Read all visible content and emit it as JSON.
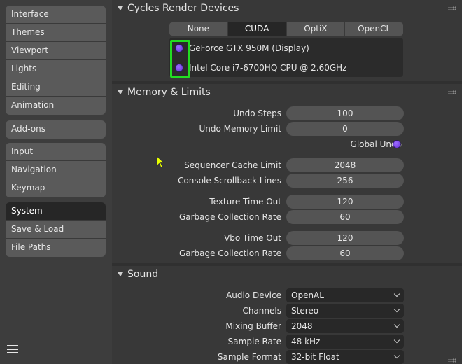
{
  "sidebar": {
    "groups": [
      [
        "Interface",
        "Themes",
        "Viewport",
        "Lights",
        "Editing",
        "Animation"
      ],
      [
        "Add-ons"
      ],
      [
        "Input",
        "Navigation",
        "Keymap"
      ],
      [
        "System",
        "Save & Load",
        "File Paths"
      ]
    ],
    "active": "System"
  },
  "cycles": {
    "title": "Cycles Render Devices",
    "tabs": [
      "None",
      "CUDA",
      "OptiX",
      "OpenCL"
    ],
    "active_tab": "CUDA",
    "devices": [
      "GeForce GTX 950M (Display)",
      "Intel Core i7-6700HQ CPU @ 2.60GHz"
    ]
  },
  "memory": {
    "title": "Memory & Limits",
    "undo_steps": {
      "label": "Undo Steps",
      "value": "100"
    },
    "undo_memory_limit": {
      "label": "Undo Memory Limit",
      "value": "0"
    },
    "global_undo": {
      "label": "Global Undo"
    },
    "sequencer_cache_limit": {
      "label": "Sequencer Cache Limit",
      "value": "2048"
    },
    "console_scrollback_lines": {
      "label": "Console Scrollback Lines",
      "value": "256"
    },
    "texture_time_out": {
      "label": "Texture Time Out",
      "value": "120"
    },
    "texture_gc_rate": {
      "label": "Garbage Collection Rate",
      "value": "60"
    },
    "vbo_time_out": {
      "label": "Vbo Time Out",
      "value": "120"
    },
    "vbo_gc_rate": {
      "label": "Garbage Collection Rate",
      "value": "60"
    }
  },
  "sound": {
    "title": "Sound",
    "audio_device": {
      "label": "Audio Device",
      "value": "OpenAL"
    },
    "channels": {
      "label": "Channels",
      "value": "Stereo"
    },
    "mixing_buffer": {
      "label": "Mixing Buffer",
      "value": "2048"
    },
    "sample_rate": {
      "label": "Sample Rate",
      "value": "48 kHz"
    },
    "sample_format": {
      "label": "Sample Format",
      "value": "32-bit Float"
    }
  },
  "colors": {
    "highlight": "#22dd22",
    "radio": "#7a3ff0",
    "active_tab": "#262626"
  }
}
